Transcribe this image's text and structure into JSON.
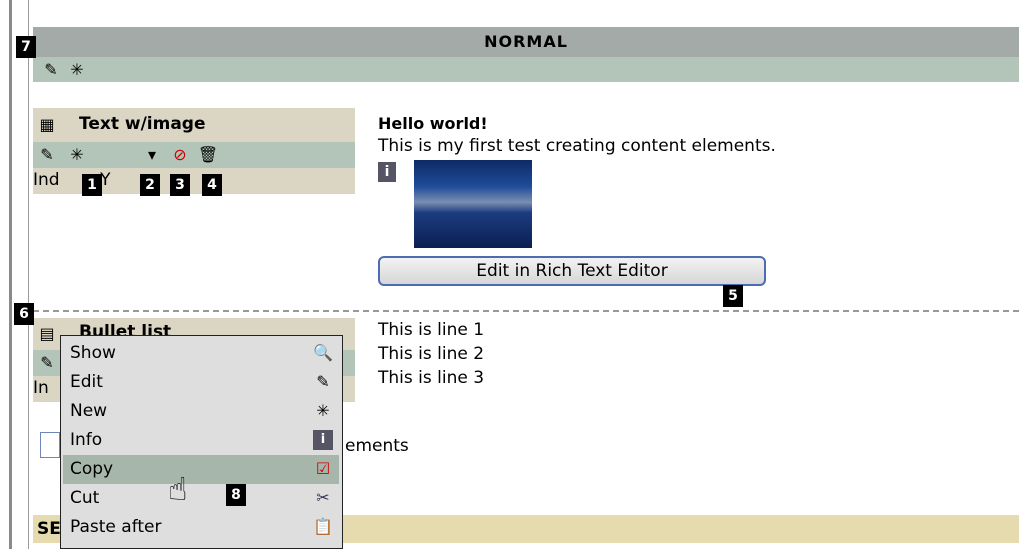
{
  "column": {
    "header": "NORMAL",
    "badge": "7"
  },
  "element1": {
    "title": "Text w/image",
    "index_label": "Ind",
    "index_suffix": ": Y",
    "badges": [
      "1",
      "2",
      "3",
      "4"
    ],
    "content": {
      "heading": "Hello world!",
      "body": "This is my first test creating content elements."
    },
    "rte_button": "Edit in Rich Text Editor",
    "rte_badge": "5"
  },
  "element2": {
    "title": "Bullet list",
    "badge": "6",
    "index_label": "In",
    "lines": [
      "This is line 1",
      "This is line 2",
      "This is line 3"
    ]
  },
  "partial_text": {
    "elements": "ements",
    "section": "SE"
  },
  "context_menu": {
    "items": [
      {
        "label": "Show",
        "icon": "magnifier-icon"
      },
      {
        "label": "Edit",
        "icon": "pencil-icon"
      },
      {
        "label": "New",
        "icon": "new-record-icon"
      },
      {
        "label": "Info",
        "icon": "info-icon"
      },
      {
        "label": "Copy",
        "icon": "copy-icon",
        "highlighted": true
      },
      {
        "label": "Cut",
        "icon": "scissors-icon"
      },
      {
        "label": "Paste after",
        "icon": "paste-icon"
      }
    ],
    "badge": "8"
  },
  "colors": {
    "header_bg": "#a3aaa8",
    "tool_bg": "#b3c4b8",
    "element_bg": "#dbd5c4",
    "section_bg": "#e5dbaf",
    "menu_bg": "#dedede",
    "menu_highlight": "#a6b6ab"
  }
}
